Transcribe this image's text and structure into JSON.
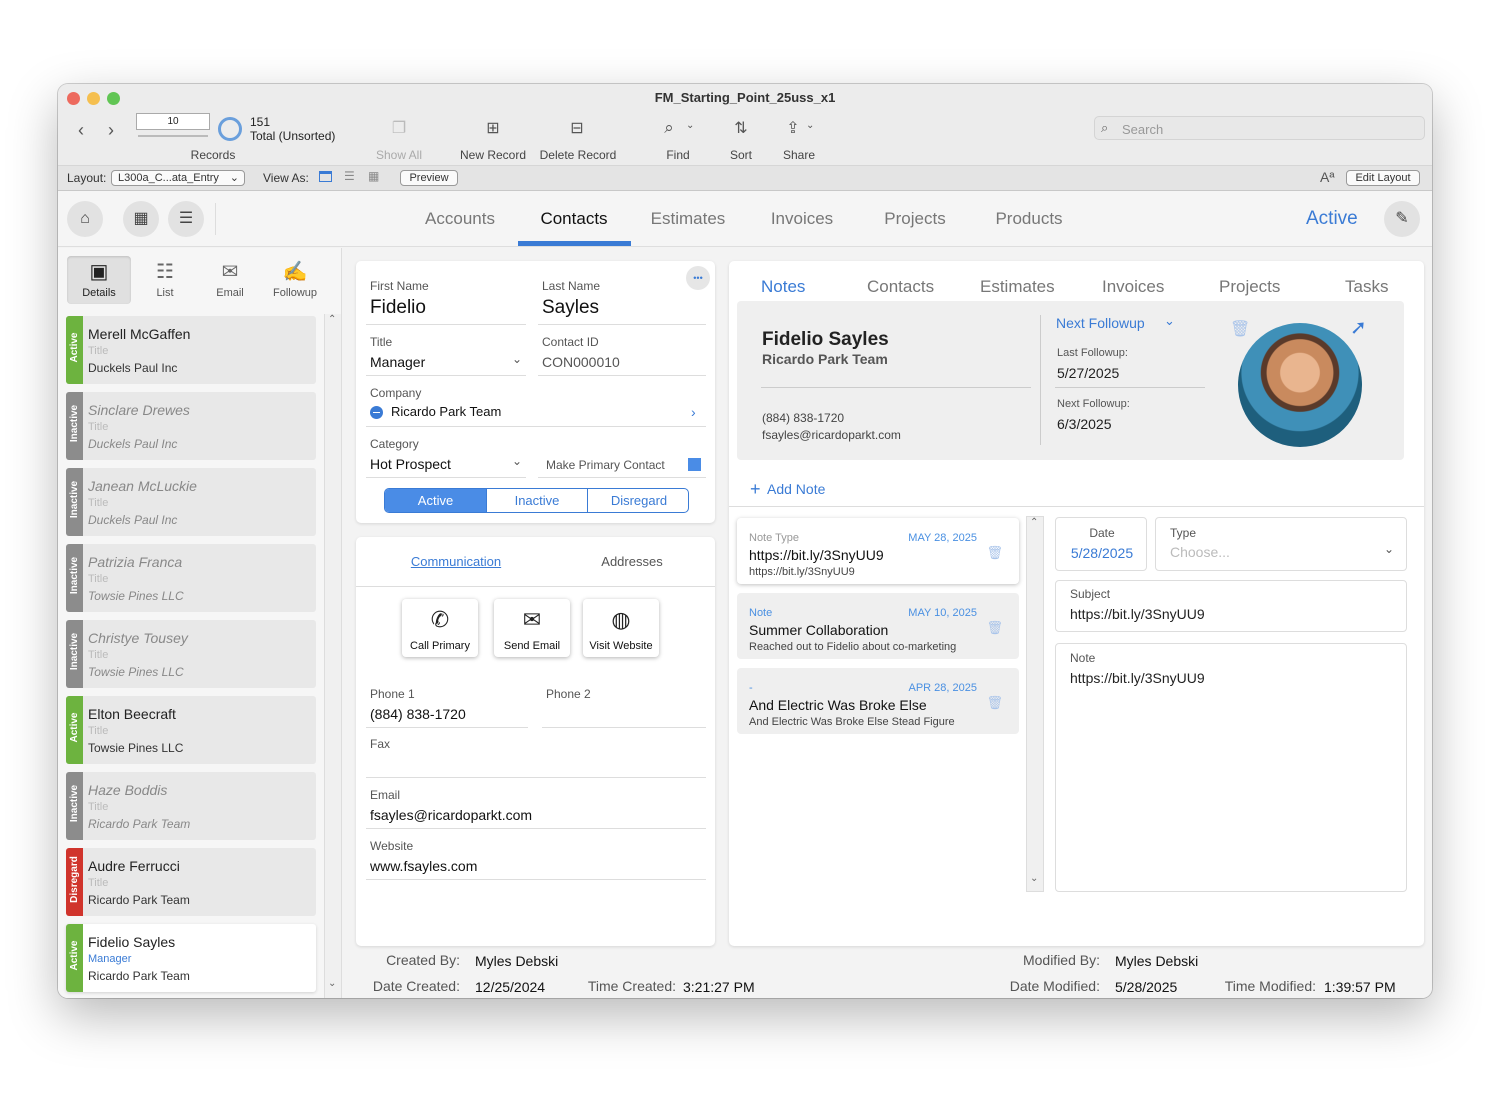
{
  "window": {
    "title": "FM_Starting_Point_25uss_x1"
  },
  "toolbar": {
    "slider_value": "10",
    "record_count": "151",
    "record_status": "Total (Unsorted)",
    "records_label": "Records",
    "show_all": "Show All",
    "new_record": "New Record",
    "delete_record": "Delete Record",
    "find": "Find",
    "sort": "Sort",
    "share": "Share",
    "search_placeholder": "Search"
  },
  "layoutbar": {
    "layout_label": "Layout:",
    "layout_value": "L300a_C...ata_Entry",
    "view_as_label": "View As:",
    "preview": "Preview",
    "font_icon": "Aª",
    "edit_layout": "Edit Layout"
  },
  "nav": {
    "tabs": [
      "Accounts",
      "Contacts",
      "Estimates",
      "Invoices",
      "Projects",
      "Products"
    ],
    "selected": "Contacts",
    "status": "Active"
  },
  "sidebar": {
    "views": [
      "Details",
      "List",
      "Email",
      "Followup"
    ],
    "records": [
      {
        "name": "Merell McGaffen",
        "title": "Title",
        "company": "Duckels Paul Inc",
        "status": "Active"
      },
      {
        "name": "Sinclare Drewes",
        "title": "Title",
        "company": "Duckels Paul Inc",
        "status": "Inactive"
      },
      {
        "name": "Janean McLuckie",
        "title": "Title",
        "company": "Duckels Paul Inc",
        "status": "Inactive"
      },
      {
        "name": "Patrizia Franca",
        "title": "Title",
        "company": "Towsie Pines LLC",
        "status": "Inactive"
      },
      {
        "name": "Christye Tousey",
        "title": "Title",
        "company": "Towsie Pines LLC",
        "status": "Inactive"
      },
      {
        "name": "Elton Beecraft",
        "title": "Title",
        "company": "Towsie Pines LLC",
        "status": "Active"
      },
      {
        "name": "Haze Boddis",
        "title": "Title",
        "company": "Ricardo Park Team",
        "status": "Inactive"
      },
      {
        "name": "Audre Ferrucci",
        "title": "Title",
        "company": "Ricardo Park Team",
        "status": "Disregard"
      },
      {
        "name": "Fidelio Sayles",
        "title": "Manager",
        "company": "Ricardo Park Team",
        "status": "Active"
      }
    ]
  },
  "contact": {
    "first_name_label": "First Name",
    "first_name": "Fidelio",
    "last_name_label": "Last Name",
    "last_name": "Sayles",
    "title_label": "Title",
    "title": "Manager",
    "contact_id_label": "Contact ID",
    "contact_id": "CON000010",
    "company_label": "Company",
    "company": "Ricardo Park Team",
    "category_label": "Category",
    "category": "Hot Prospect",
    "make_primary_label": "Make Primary Contact",
    "status_options": [
      "Active",
      "Inactive",
      "Disregard"
    ],
    "status_selected": "Active",
    "more_icon": "•••"
  },
  "communication": {
    "tabs": [
      "Communication",
      "Addresses"
    ],
    "buttons": [
      "Call Primary",
      "Send Email",
      "Visit Website"
    ],
    "phone1_label": "Phone 1",
    "phone1": "(884) 838-1720",
    "phone2_label": "Phone 2",
    "phone2": "",
    "fax_label": "Fax",
    "fax": "",
    "email_label": "Email",
    "email": "fsayles@ricardoparkt.com",
    "website_label": "Website",
    "website": "www.fsayles.com"
  },
  "right": {
    "tabs": [
      "Notes",
      "Contacts",
      "Estimates",
      "Invoices",
      "Projects",
      "Tasks"
    ],
    "selected": "Notes",
    "header_name": "Fidelio Sayles",
    "header_company": "Ricardo Park Team",
    "header_phone": "(884) 838-1720",
    "header_email": "fsayles@ricardoparkt.com",
    "next_followup_dropdown": "Next Followup",
    "last_followup_label": "Last Followup:",
    "last_followup": "5/27/2025",
    "next_followup_label": "Next Followup:",
    "next_followup": "6/3/2025",
    "add_note": "Add Note",
    "notes": [
      {
        "type": "Note Type",
        "date": "MAY 28, 2025",
        "subject": "https://bit.ly/3SnyUU9",
        "body": "https://bit.ly/3SnyUU9"
      },
      {
        "type": "Note",
        "date": "MAY 10, 2025",
        "subject": "Summer Collaboration",
        "body": "Reached out to Fidelio about co-marketing"
      },
      {
        "type": "-",
        "date": "APR 28, 2025",
        "subject": "And Electric Was Broke Else",
        "body": "And Electric Was Broke Else Stead Figure"
      }
    ],
    "detail": {
      "date_label": "Date",
      "date": "5/28/2025",
      "type_label": "Type",
      "type_placeholder": "Choose...",
      "subject_label": "Subject",
      "subject": "https://bit.ly/3SnyUU9",
      "note_label": "Note",
      "note": "https://bit.ly/3SnyUU9"
    }
  },
  "footer": {
    "created_by_label": "Created By:",
    "created_by": "Myles Debski",
    "date_created_label": "Date Created:",
    "date_created": "12/25/2024",
    "time_created_label": "Time Created:",
    "time_created": "3:21:27 PM",
    "modified_by_label": "Modified By:",
    "modified_by": "Myles Debski",
    "date_modified_label": "Date Modified:",
    "date_modified": "5/28/2025",
    "time_modified_label": "Time Modified:",
    "time_modified": "1:39:57 PM"
  },
  "colors": {
    "accent": "#3a7bd5",
    "active": "#6db33f",
    "inactive": "#8c8c8c",
    "disregard": "#d0342c"
  }
}
